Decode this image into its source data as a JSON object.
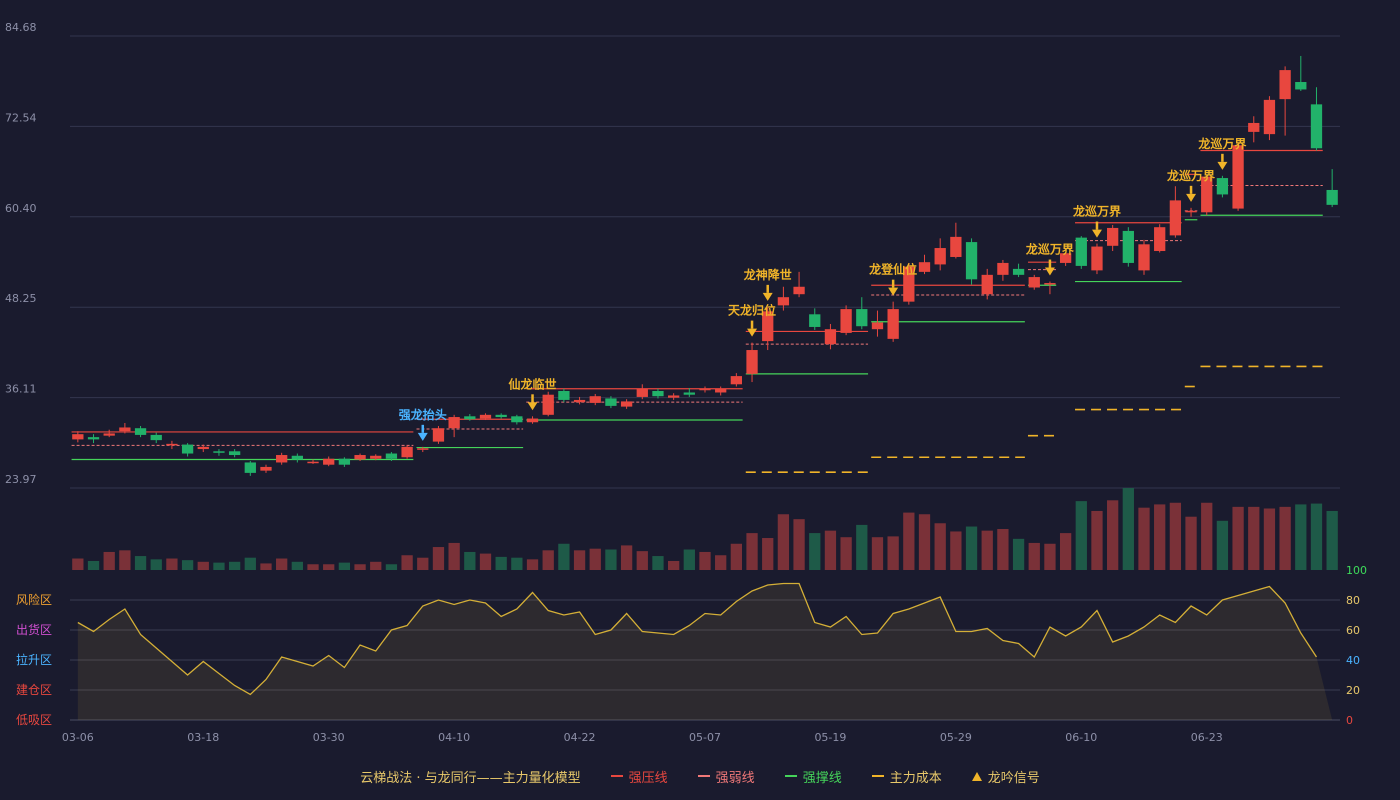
{
  "chart_data": {
    "type": "candlestick",
    "title": "",
    "price_axis": {
      "ticks": [
        "84.68",
        "72.54",
        "60.40",
        "48.25",
        "36.11",
        "23.97"
      ],
      "min": 23.97,
      "max": 84.68
    },
    "x_ticks": [
      {
        "label": "03-06",
        "index": 0
      },
      {
        "label": "03-18",
        "index": 8
      },
      {
        "label": "03-30",
        "index": 16
      },
      {
        "label": "04-10",
        "index": 24
      },
      {
        "label": "04-22",
        "index": 32
      },
      {
        "label": "05-07",
        "index": 40
      },
      {
        "label": "05-19",
        "index": 48
      },
      {
        "label": "05-29",
        "index": 56
      },
      {
        "label": "06-10",
        "index": 64
      },
      {
        "label": "06-23",
        "index": 72
      }
    ],
    "candles": [
      [
        30.5,
        31.2,
        31.6,
        30.1
      ],
      [
        30.8,
        30.5,
        31.2,
        30.0
      ],
      [
        31.0,
        31.3,
        31.8,
        30.8
      ],
      [
        31.6,
        32.1,
        32.7,
        31.3
      ],
      [
        32.0,
        31.1,
        32.3,
        30.8
      ],
      [
        31.1,
        30.4,
        31.4,
        30.0
      ],
      [
        29.7,
        29.9,
        30.3,
        29.2
      ],
      [
        29.8,
        28.6,
        30.0,
        28.2
      ],
      [
        29.2,
        29.5,
        29.8,
        28.8
      ],
      [
        28.9,
        28.7,
        29.2,
        28.3
      ],
      [
        28.9,
        28.4,
        29.2,
        28.1
      ],
      [
        27.4,
        26.0,
        27.6,
        25.6
      ],
      [
        26.3,
        26.8,
        27.1,
        26.0
      ],
      [
        27.4,
        28.4,
        28.7,
        27.1
      ],
      [
        28.3,
        27.8,
        28.6,
        27.4
      ],
      [
        27.4,
        27.5,
        27.8,
        27.2
      ],
      [
        27.1,
        27.9,
        28.2,
        26.9
      ],
      [
        27.9,
        27.1,
        28.1,
        26.8
      ],
      [
        27.8,
        28.4,
        28.6,
        27.6
      ],
      [
        27.9,
        28.3,
        28.5,
        27.7
      ],
      [
        28.6,
        27.9,
        28.8,
        27.6
      ],
      [
        28.1,
        29.5,
        29.7,
        27.9
      ],
      [
        29.1,
        29.3,
        29.5,
        28.8
      ],
      [
        30.2,
        32.0,
        32.3,
        29.9
      ],
      [
        32.0,
        33.5,
        33.8,
        30.8
      ],
      [
        33.6,
        33.2,
        33.9,
        33.0
      ],
      [
        33.3,
        33.8,
        34.0,
        33.1
      ],
      [
        33.8,
        33.5,
        34.0,
        33.3
      ],
      [
        33.6,
        32.8,
        33.8,
        32.5
      ],
      [
        32.8,
        33.3,
        33.6,
        32.6
      ],
      [
        33.8,
        36.5,
        36.9,
        33.6
      ],
      [
        37.0,
        35.8,
        37.3,
        35.5
      ],
      [
        35.5,
        35.8,
        36.2,
        35.2
      ],
      [
        35.4,
        36.3,
        36.6,
        35.1
      ],
      [
        36.0,
        35.0,
        36.3,
        34.7
      ],
      [
        34.9,
        35.6,
        35.9,
        34.6
      ],
      [
        36.2,
        37.3,
        37.9,
        35.9
      ],
      [
        37.0,
        36.3,
        37.3,
        36.0
      ],
      [
        36.1,
        36.4,
        36.7,
        35.8
      ],
      [
        36.8,
        36.5,
        37.4,
        36.2
      ],
      [
        37.1,
        37.3,
        37.6,
        36.8
      ],
      [
        36.8,
        37.3,
        37.6,
        36.4
      ],
      [
        37.9,
        39.0,
        39.4,
        37.6
      ],
      [
        39.3,
        42.5,
        43.5,
        38.2
      ],
      [
        43.7,
        47.7,
        48.3,
        42.5
      ],
      [
        48.5,
        49.6,
        51.0,
        47.8
      ],
      [
        50.0,
        51.0,
        53.0,
        49.6
      ],
      [
        47.3,
        45.6,
        48.1,
        45.2
      ],
      [
        43.3,
        45.3,
        46.0,
        42.6
      ],
      [
        44.8,
        48.0,
        48.5,
        44.5
      ],
      [
        48.0,
        45.7,
        49.6,
        45.3
      ],
      [
        45.3,
        46.2,
        47.8,
        44.3
      ],
      [
        44.0,
        48.0,
        49.0,
        43.6
      ],
      [
        49.0,
        53.7,
        54.2,
        48.6
      ],
      [
        53.0,
        54.3,
        55.3,
        52.7
      ],
      [
        54.0,
        56.2,
        57.5,
        53.2
      ],
      [
        55.0,
        57.7,
        59.6,
        54.8
      ],
      [
        57.0,
        52.0,
        57.5,
        51.3
      ],
      [
        50.0,
        52.6,
        53.4,
        49.3
      ],
      [
        52.6,
        54.2,
        54.6,
        51.8
      ],
      [
        53.4,
        52.6,
        54.1,
        52.3
      ],
      [
        50.9,
        52.3,
        52.6,
        50.6
      ],
      [
        51.3,
        51.5,
        51.7,
        50.0
      ],
      [
        54.2,
        55.5,
        55.6,
        53.8
      ],
      [
        57.6,
        53.8,
        57.8,
        53.4
      ],
      [
        53.2,
        56.4,
        56.8,
        52.7
      ],
      [
        56.5,
        58.9,
        59.3,
        55.8
      ],
      [
        58.5,
        54.2,
        59.0,
        53.7
      ],
      [
        53.2,
        56.7,
        57.3,
        52.6
      ],
      [
        55.8,
        59.0,
        59.4,
        55.6
      ],
      [
        57.9,
        62.6,
        64.5,
        57.6
      ],
      [
        61.1,
        61.2,
        61.6,
        60.4
      ],
      [
        61.0,
        65.8,
        66.0,
        60.6
      ],
      [
        65.6,
        63.4,
        65.9,
        63.0
      ],
      [
        61.5,
        70.0,
        70.2,
        61.2
      ],
      [
        71.8,
        73.0,
        73.9,
        70.4
      ],
      [
        71.5,
        76.1,
        76.6,
        70.7
      ],
      [
        76.2,
        80.1,
        80.6,
        71.3
      ],
      [
        78.5,
        77.5,
        82.0,
        77.3
      ],
      [
        75.5,
        69.6,
        77.8,
        69.3
      ],
      [
        64.0,
        62.0,
        66.8,
        61.7
      ]
    ],
    "volume": [
      14,
      11,
      22,
      24,
      17,
      13,
      14,
      12,
      10,
      9,
      10,
      15,
      8,
      14,
      10,
      7,
      7,
      9,
      7,
      10,
      7,
      18,
      15,
      28,
      33,
      22,
      20,
      16,
      15,
      13,
      24,
      32,
      24,
      26,
      25,
      30,
      23,
      17,
      11,
      25,
      22,
      18,
      32,
      45,
      39,
      68,
      62,
      45,
      48,
      40,
      55,
      40,
      41,
      70,
      68,
      57,
      47,
      53,
      48,
      50,
      38,
      33,
      32,
      45,
      84,
      72,
      85,
      100,
      76,
      80,
      82,
      65,
      82,
      60,
      77,
      77,
      75,
      77,
      80,
      81,
      72
    ],
    "oscillator": {
      "range": [
        0,
        100
      ],
      "ticks": [
        "100",
        "80",
        "60",
        "40",
        "20",
        "0"
      ],
      "zones": [
        "风险区",
        "出货区",
        "拉升区",
        "建仓区",
        "低吸区"
      ],
      "values": [
        65,
        59,
        67,
        74,
        57,
        48,
        39,
        30,
        39,
        31,
        23,
        17,
        27,
        42,
        39,
        36,
        43,
        35,
        50,
        46,
        60,
        63,
        76,
        80,
        77,
        80,
        78,
        69,
        74,
        85,
        73,
        70,
        72,
        57,
        60,
        71,
        59,
        58,
        57,
        63,
        71,
        70,
        79,
        86,
        90,
        91,
        91,
        65,
        62,
        69,
        57,
        58,
        71,
        74,
        78,
        82,
        59,
        59,
        61,
        53,
        51,
        42,
        62,
        56,
        62,
        73,
        52,
        56,
        62,
        70,
        65,
        76,
        70,
        80,
        83,
        86,
        89,
        78,
        58,
        42
      ]
    },
    "segments": [
      {
        "start": 0,
        "end": 21,
        "resist": 31.5,
        "weak": 29.7,
        "support": 27.8
      },
      {
        "start": 22,
        "end": 28,
        "resist": 33.2,
        "weak": 31.9,
        "support": 29.4,
        "cost": null
      },
      {
        "start": 29,
        "end": 42,
        "resist": 37.3,
        "weak": 35.5,
        "support": 33.1
      },
      {
        "start": 43,
        "end": 50,
        "resist": 45.0,
        "weak": 43.3,
        "support": 39.3,
        "cost": 26.1
      },
      {
        "start": 51,
        "end": 60,
        "resist": 51.2,
        "weak": 49.9,
        "support": 46.3,
        "cost": 28.1
      },
      {
        "start": 61,
        "end": 62,
        "resist": 54.3,
        "weak": 53.3,
        "support": 51.2,
        "cost": 31.0
      },
      {
        "start": 64,
        "end": 70,
        "resist": 59.6,
        "weak": 57.2,
        "support": 51.7,
        "cost": 34.5
      },
      {
        "start": 71,
        "end": 71,
        "resist": 66.1,
        "weak": 61.2,
        "support": 60.0,
        "cost": 37.6
      },
      {
        "start": 72,
        "end": 79,
        "resist": 69.3,
        "weak": 64.6,
        "support": 60.6,
        "cost": 40.3
      }
    ],
    "signals": [
      {
        "index": 22,
        "label": "强龙抬头",
        "color": "#4ab3ff"
      },
      {
        "index": 29,
        "label": "仙龙临世",
        "color": "#f0b429"
      },
      {
        "index": 43,
        "label": "天龙归位",
        "color": "#f0b429"
      },
      {
        "index": 44,
        "label": "龙神降世",
        "color": "#f0b429"
      },
      {
        "index": 52,
        "label": "龙登仙位",
        "color": "#f0b429"
      },
      {
        "index": 62,
        "label": "龙巡万界",
        "color": "#f0b429"
      },
      {
        "index": 65,
        "label": "龙巡万界",
        "color": "#f0b429"
      },
      {
        "index": 71,
        "label": "龙巡万界",
        "color": "#f0b429"
      },
      {
        "index": 73,
        "label": "龙巡万界",
        "color": "#f0b429"
      }
    ],
    "colors": {
      "up": "#e8473f",
      "down": "#22b26a",
      "resist": "#e8473f",
      "weak": "#f07878",
      "support": "#45d45a",
      "cost": "#f0b429",
      "osc": "#d4af37"
    }
  },
  "legend": {
    "model": "云梯战法 · 与龙同行——主力量化模型",
    "resist": "强压线",
    "weak": "强弱线",
    "support": "强撑线",
    "cost": "主力成本",
    "signal": "龙吟信号"
  }
}
